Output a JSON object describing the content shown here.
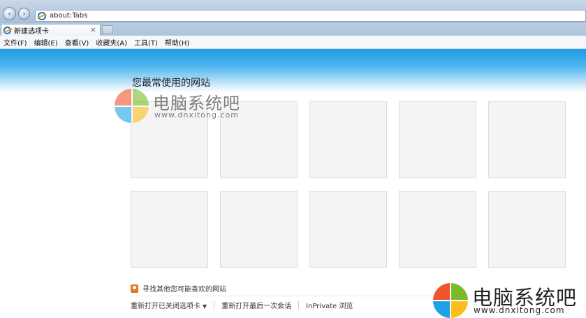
{
  "browser": {
    "address": "about:Tabs",
    "tab_title": "新建选项卡",
    "tab_close": "×"
  },
  "menu": [
    "文件(F)",
    "编辑(E)",
    "查看(V)",
    "收藏夹(A)",
    "工具(T)",
    "帮助(H)"
  ],
  "main": {
    "section_title": "您最常使用的网站",
    "discover_label": "寻找其他您可能喜欢的网站",
    "footer_links": [
      "重新打开已关闭选项卡",
      "重新打开最后一次会话",
      "InPrivate 浏览"
    ]
  },
  "watermark": {
    "title": "电脑系统吧",
    "url": "www.dnxitong.com"
  },
  "icons": {
    "nav_back": "back-arrow-icon",
    "nav_forward": "forward-arrow-icon",
    "page": "ie-icon",
    "discover": "lightbulb-icon"
  }
}
